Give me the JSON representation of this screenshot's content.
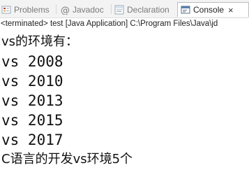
{
  "tabs": [
    {
      "label": "Problems",
      "icon": "problems-icon",
      "active": false
    },
    {
      "label": "Javadoc",
      "icon": "at-icon",
      "active": false
    },
    {
      "label": "Declaration",
      "icon": "declaration-icon",
      "active": false
    },
    {
      "label": "Console",
      "icon": "console-icon",
      "active": true,
      "close": "×"
    }
  ],
  "status": "<terminated> test [Java Application] C:\\Program Files\\Java\\jd",
  "console": {
    "lines": [
      "vs的环境有：",
      "vs 2008",
      "vs 2010",
      "vs 2013",
      "vs 2015",
      "vs 2017",
      "C语言的开发vs环境5个"
    ]
  }
}
